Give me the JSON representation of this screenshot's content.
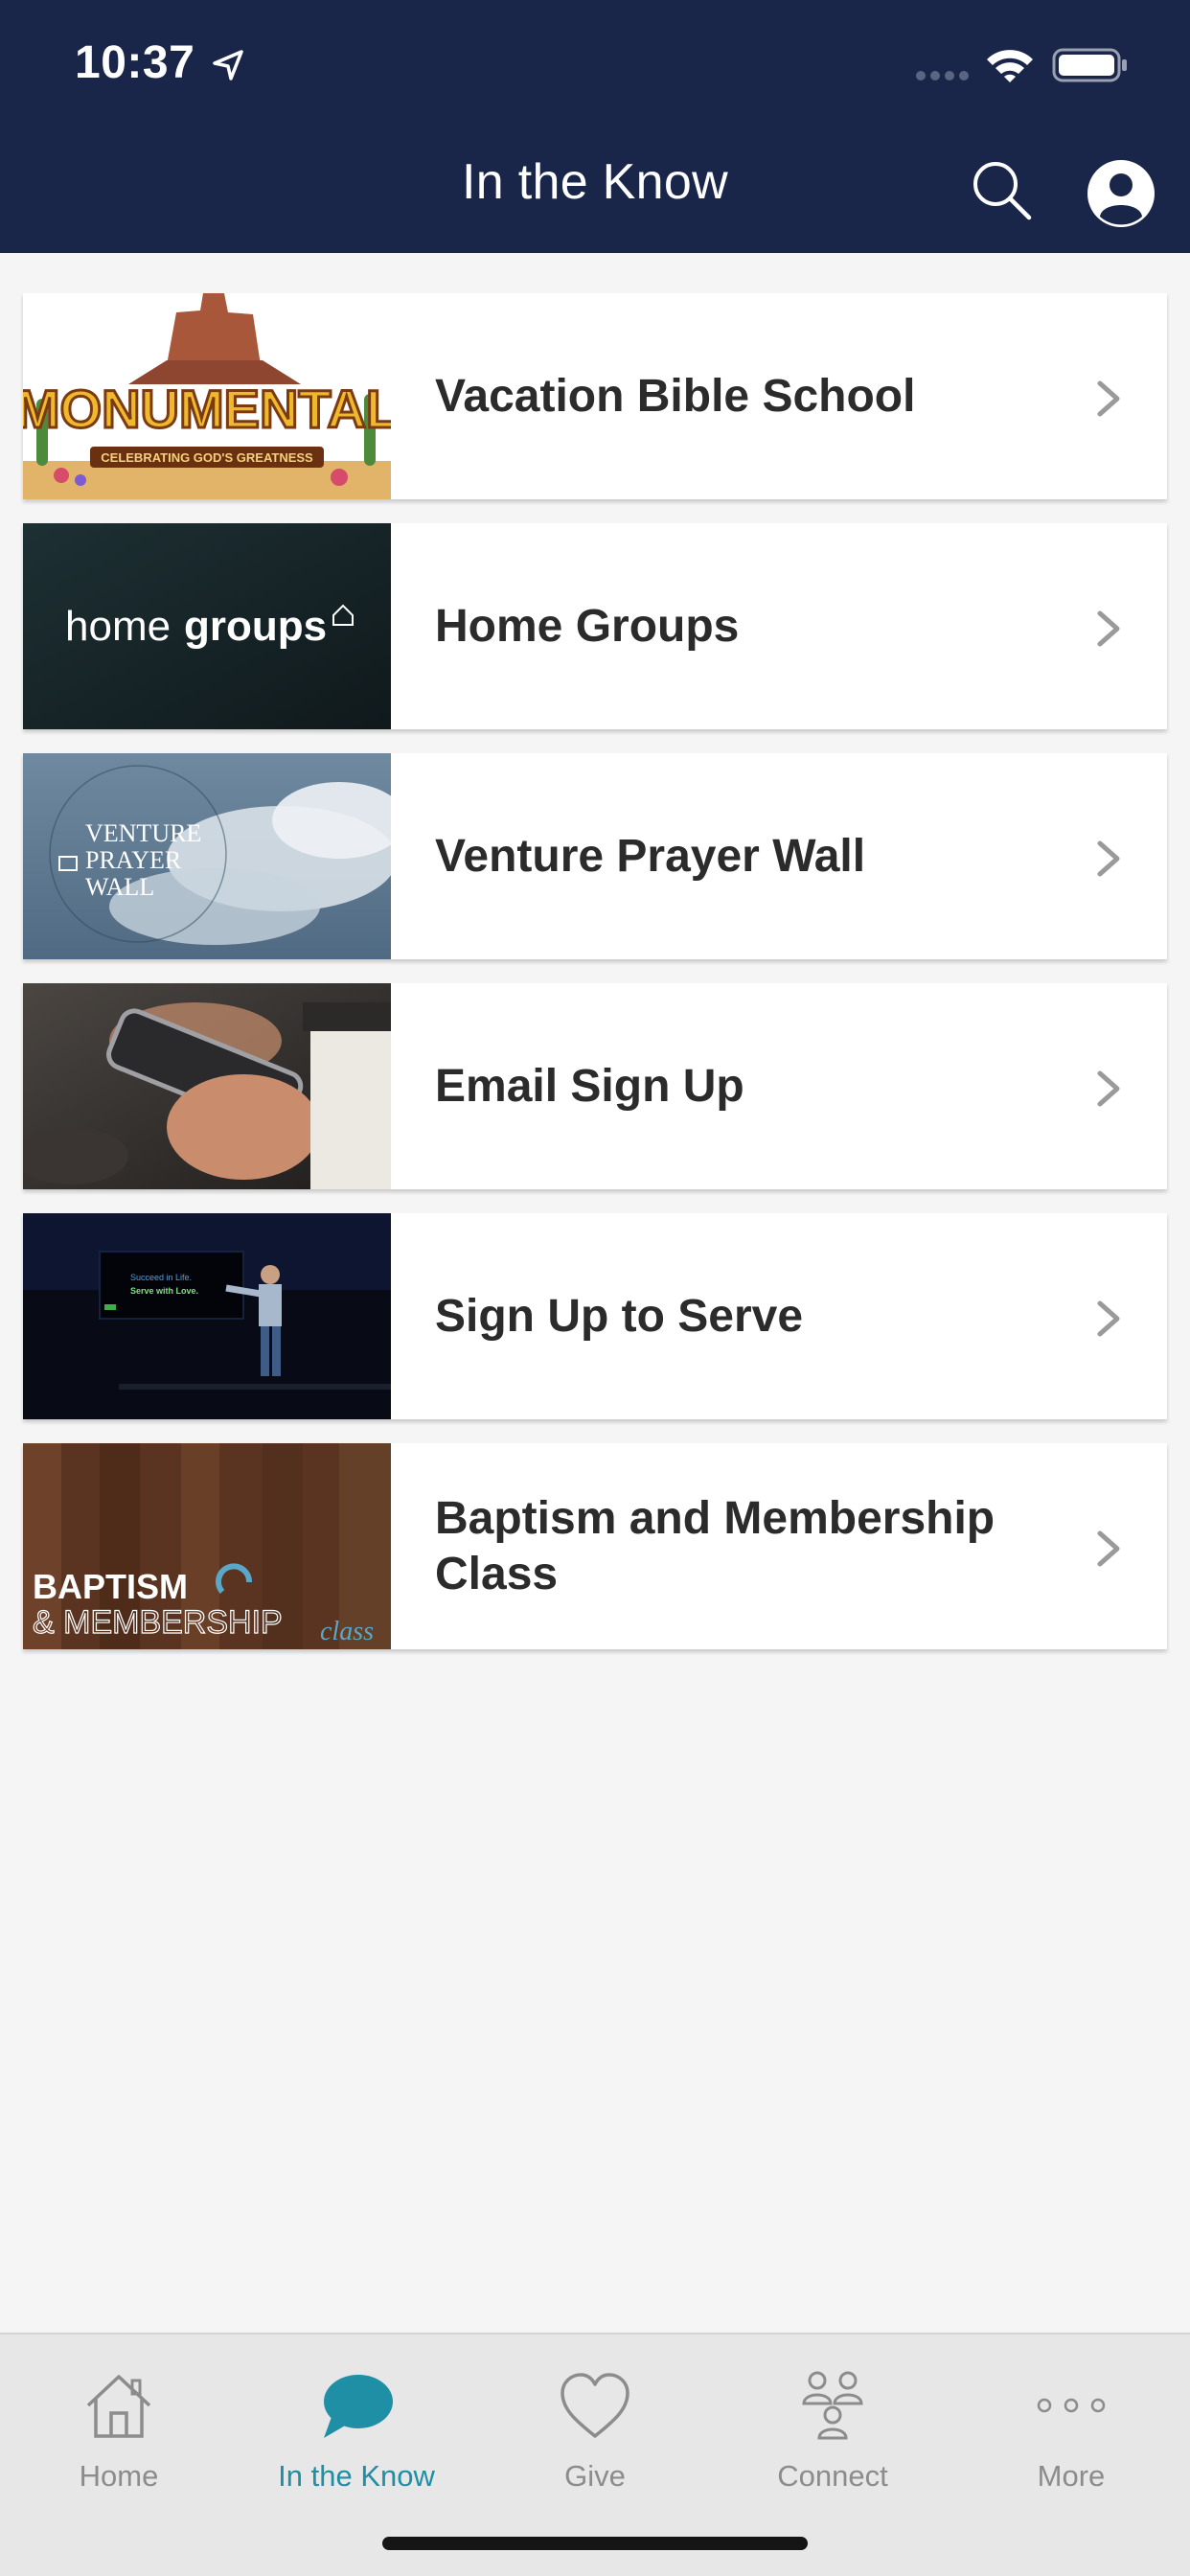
{
  "status": {
    "time": "10:37"
  },
  "header": {
    "title": "In the Know"
  },
  "colors": {
    "header_bg": "#1a2649",
    "accent": "#1f8fa6",
    "tab_inactive": "#8c8c8c"
  },
  "items": [
    {
      "label": "Vacation Bible School",
      "thumb_text": "MONUMENTAL",
      "thumb_subtext": "CELEBRATING GOD'S GREATNESS"
    },
    {
      "label": "Home Groups",
      "thumb_text": "home",
      "thumb_text_bold": "groups"
    },
    {
      "label": "Venture Prayer Wall",
      "thumb_text": "VENTURE",
      "thumb_text2": "PRAYER",
      "thumb_text3": "WALL"
    },
    {
      "label": "Email Sign Up"
    },
    {
      "label": "Sign Up to Serve",
      "thumb_text": "Succeed in Life.",
      "thumb_text2": "Serve with Love."
    },
    {
      "label": "Baptism and Membership Class",
      "thumb_text": "BAPTISM",
      "thumb_text2": "& MEMBERSHIP",
      "thumb_text3": "class"
    }
  ],
  "tabs": [
    {
      "label": "Home",
      "icon": "home-icon"
    },
    {
      "label": "In the Know",
      "icon": "chat-bubble-icon",
      "active": true
    },
    {
      "label": "Give",
      "icon": "heart-icon"
    },
    {
      "label": "Connect",
      "icon": "people-icon"
    },
    {
      "label": "More",
      "icon": "more-dots-icon"
    }
  ]
}
